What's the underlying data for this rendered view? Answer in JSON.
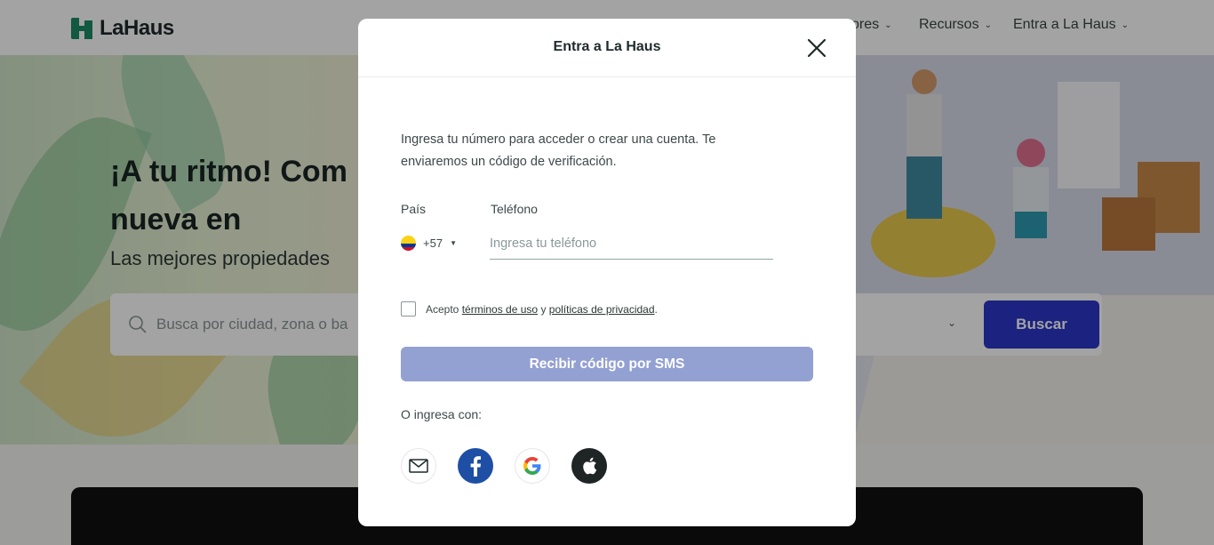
{
  "header": {
    "logo_text": "LaHaus",
    "nav": {
      "item_partial": "ores",
      "resources": "Recursos",
      "login": "Entra a La Haus"
    }
  },
  "hero": {
    "title_line1": "¡A tu ritmo! Com",
    "title_line2": "nueva en",
    "subtitle": "Las mejores propiedades",
    "search_placeholder": "Busca por ciudad, zona o ba",
    "search_button": "Buscar"
  },
  "modal": {
    "title": "Entra a La Haus",
    "intro": "Ingresa tu número para acceder o crear una cuenta. Te enviaremos un código de verificación.",
    "country_label": "País",
    "phone_label": "Teléfono",
    "country_code": "+57",
    "phone_placeholder": "Ingresa tu teléfono",
    "phone_value": "",
    "terms_prefix": "Acepto",
    "terms_link": "términos de uso",
    "terms_and": "y",
    "privacy_link": "políticas de privacidad",
    "terms_suffix": ".",
    "sms_button": "Recibir código por SMS",
    "or_text": "O ingresa con:",
    "social": [
      "mail-icon",
      "facebook-icon",
      "google-icon",
      "apple-icon"
    ]
  },
  "colors": {
    "brand_green": "#1e8a64",
    "primary_blue": "#2b36c8",
    "sms_button_disabled": "#93a0d2",
    "facebook_blue": "#1e4fa5"
  }
}
